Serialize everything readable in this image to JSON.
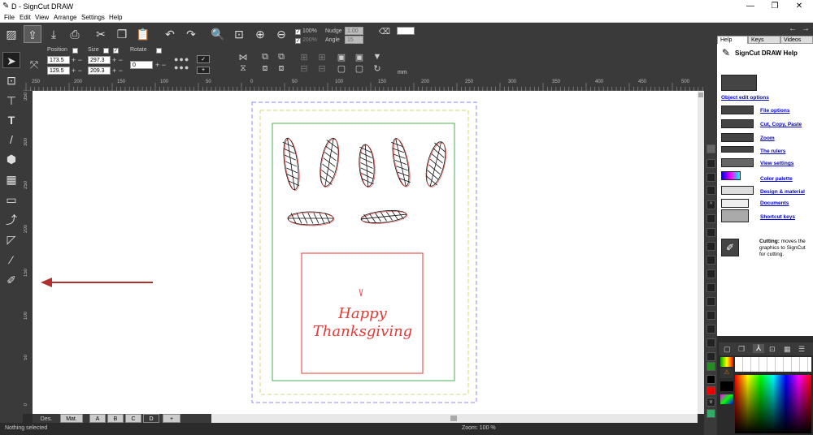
{
  "window": {
    "title": "D - SignCut DRAW"
  },
  "menu": [
    "File",
    "Edit",
    "View",
    "Arrange",
    "Settings",
    "Help"
  ],
  "toolbar": {
    "snap_pct": "100%",
    "grid_pct": "200%",
    "nudge_label": "Nudge",
    "nudge_value": "1.00",
    "angle_label": "Angle",
    "angle_value": "15"
  },
  "object_bar": {
    "position_label": "Position",
    "size_label": "Size",
    "rotate_label": "Rotate",
    "pos_x": "173.5",
    "pos_y": "129.5",
    "size_w": "297.3",
    "size_h": "209.3",
    "rotate_value": "0",
    "units": "mm"
  },
  "ruler": {
    "h_labels": [
      "250",
      "200",
      "150",
      "100",
      "50",
      "0",
      "50",
      "100",
      "150",
      "200",
      "250",
      "300",
      "350",
      "400",
      "450",
      "500"
    ],
    "v_labels": [
      "350",
      "300",
      "250",
      "200",
      "150",
      "100",
      "50",
      "0"
    ]
  },
  "design": {
    "text_line1": "Happy",
    "text_line2": "Thanksgiving"
  },
  "page_tabs": [
    "Des.",
    "Mat.",
    "A",
    "B",
    "C",
    "D",
    "+"
  ],
  "status": {
    "left": "Nothing selected",
    "zoom": "Zoom: 100 %"
  },
  "help": {
    "tabs": [
      "Help",
      "Keys",
      "Videos"
    ],
    "title": "SignCut DRAW Help",
    "section_link": "Object edit options",
    "links": [
      "File options",
      "Cut, Copy, Paste",
      "Zoom",
      "The rulers",
      "View settings",
      "Color palette",
      "Design & material",
      "Documents",
      "Shortcut keys"
    ],
    "cutting_bold": "Cutting:",
    "cutting_text": "moves the graphics to SignCut for cutting."
  },
  "colors": {
    "accent_red": "#e53935",
    "guide_green": "#4caf50",
    "guide_yellow": "#d4d47a",
    "guide_blue": "#8888ff",
    "arrow": "#b03030"
  }
}
